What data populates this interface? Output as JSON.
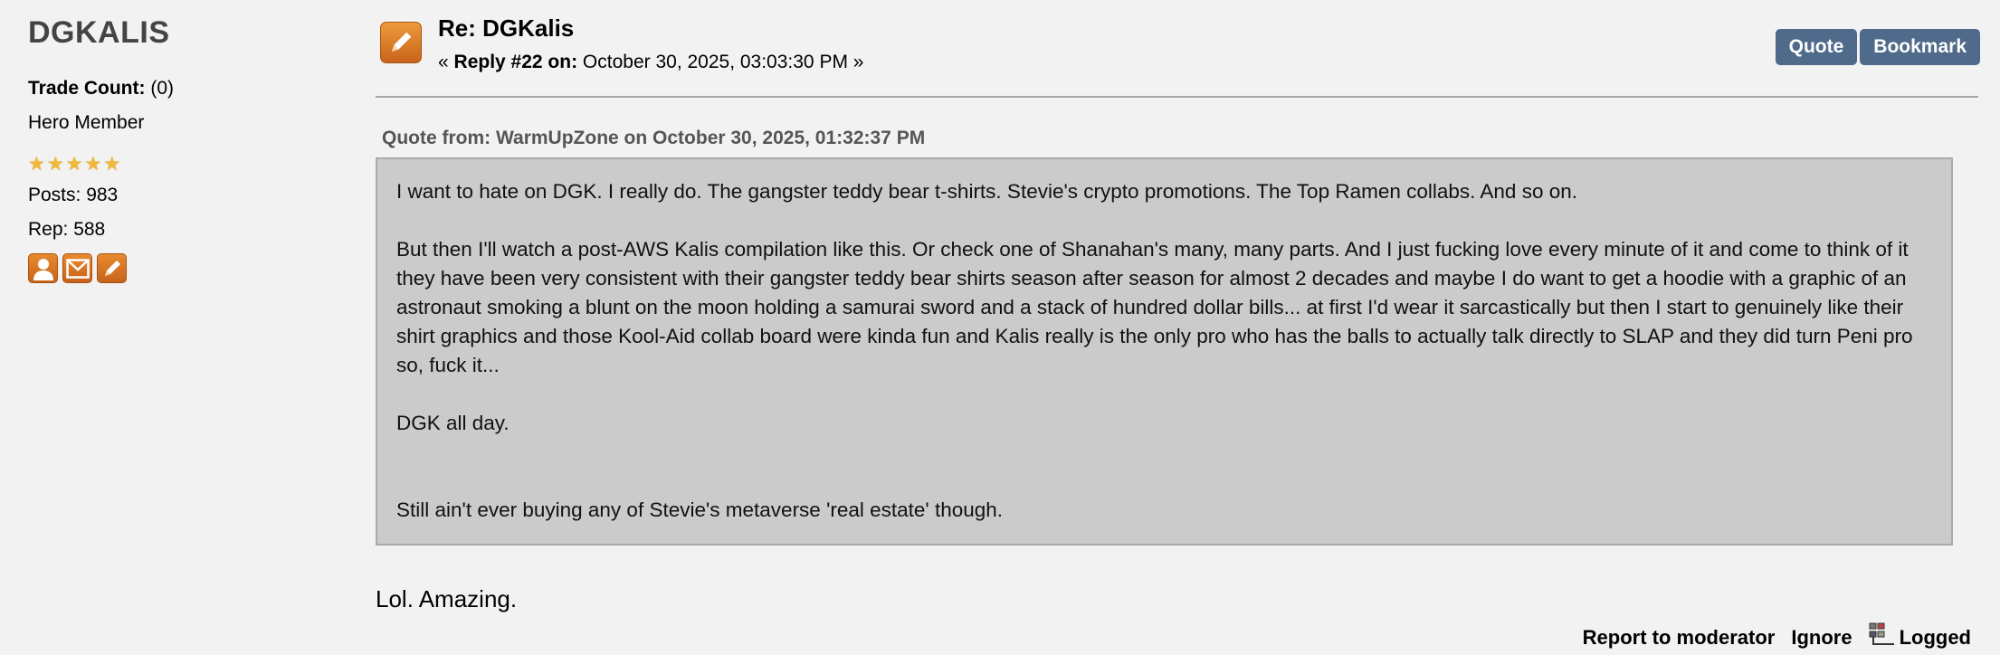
{
  "poster": {
    "name": "DGKALIS",
    "trade_count_label": "Trade Count:",
    "trade_count_value": "(0)",
    "member_title": "Hero Member",
    "star_count": 5,
    "star_color": "#f0b93a",
    "posts_label": "Posts:",
    "posts_value": "983",
    "rep_label": "Rep:",
    "rep_value": "588",
    "icons": [
      "profile-icon",
      "message-icon",
      "pencil-icon"
    ]
  },
  "post": {
    "icon": "pencil-icon",
    "title": "Re: DGKalis",
    "meta_open": "«",
    "meta_reply": "Reply #22 on:",
    "meta_date": "October 30, 2025, 03:03:30 PM",
    "meta_close": "»",
    "actions": {
      "quote_label": "Quote",
      "bookmark_label": "Bookmark",
      "button_color": "#4f6a8a"
    },
    "quote": {
      "header": "Quote from: WarmUpZone on October 30, 2025, 01:32:37 PM",
      "paragraphs": [
        "I want to hate on DGK. I really do. The gangster teddy bear t-shirts. Stevie's crypto promotions. The Top Ramen collabs. And so on.",
        "But then I'll watch a post-AWS Kalis compilation like this. Or check one of Shanahan's many, many parts. And I just fucking love every minute of it and come to think of it they have been very consistent with their gangster teddy bear shirts season after season for almost 2 decades and maybe I do want to get a hoodie with a graphic of an astronaut smoking a blunt on the moon holding a samurai sword and a stack of hundred dollar bills... at first I'd wear it sarcastically but then I start to genuinely like their shirt graphics and those Kool-Aid collab board were kinda fun and Kalis really is the only pro who has the balls to actually talk directly to SLAP and they did turn Peni pro so, fuck it...",
        "DGK all day.",
        "Still ain't ever buying any of Stevie's metaverse 'real estate' though."
      ]
    },
    "body": "Lol. Amazing.",
    "footer": {
      "report_label": "Report to moderator",
      "ignore_label": "Ignore",
      "logged_icon": "ip-logged-icon",
      "logged_label": "Logged"
    }
  }
}
